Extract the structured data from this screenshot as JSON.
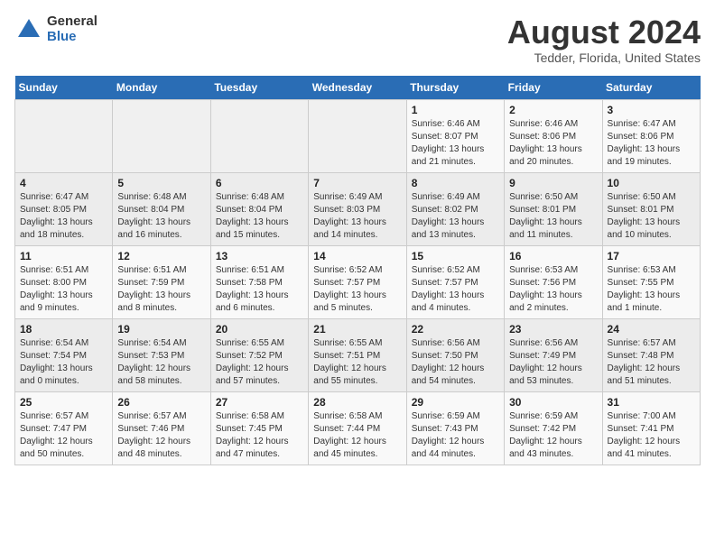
{
  "header": {
    "logo_general": "General",
    "logo_blue": "Blue",
    "title": "August 2024",
    "subtitle": "Tedder, Florida, United States"
  },
  "calendar": {
    "days_of_week": [
      "Sunday",
      "Monday",
      "Tuesday",
      "Wednesday",
      "Thursday",
      "Friday",
      "Saturday"
    ],
    "weeks": [
      [
        {
          "day": "",
          "info": ""
        },
        {
          "day": "",
          "info": ""
        },
        {
          "day": "",
          "info": ""
        },
        {
          "day": "",
          "info": ""
        },
        {
          "day": "1",
          "info": "Sunrise: 6:46 AM\nSunset: 8:07 PM\nDaylight: 13 hours\nand 21 minutes."
        },
        {
          "day": "2",
          "info": "Sunrise: 6:46 AM\nSunset: 8:06 PM\nDaylight: 13 hours\nand 20 minutes."
        },
        {
          "day": "3",
          "info": "Sunrise: 6:47 AM\nSunset: 8:06 PM\nDaylight: 13 hours\nand 19 minutes."
        }
      ],
      [
        {
          "day": "4",
          "info": "Sunrise: 6:47 AM\nSunset: 8:05 PM\nDaylight: 13 hours\nand 18 minutes."
        },
        {
          "day": "5",
          "info": "Sunrise: 6:48 AM\nSunset: 8:04 PM\nDaylight: 13 hours\nand 16 minutes."
        },
        {
          "day": "6",
          "info": "Sunrise: 6:48 AM\nSunset: 8:04 PM\nDaylight: 13 hours\nand 15 minutes."
        },
        {
          "day": "7",
          "info": "Sunrise: 6:49 AM\nSunset: 8:03 PM\nDaylight: 13 hours\nand 14 minutes."
        },
        {
          "day": "8",
          "info": "Sunrise: 6:49 AM\nSunset: 8:02 PM\nDaylight: 13 hours\nand 13 minutes."
        },
        {
          "day": "9",
          "info": "Sunrise: 6:50 AM\nSunset: 8:01 PM\nDaylight: 13 hours\nand 11 minutes."
        },
        {
          "day": "10",
          "info": "Sunrise: 6:50 AM\nSunset: 8:01 PM\nDaylight: 13 hours\nand 10 minutes."
        }
      ],
      [
        {
          "day": "11",
          "info": "Sunrise: 6:51 AM\nSunset: 8:00 PM\nDaylight: 13 hours\nand 9 minutes."
        },
        {
          "day": "12",
          "info": "Sunrise: 6:51 AM\nSunset: 7:59 PM\nDaylight: 13 hours\nand 8 minutes."
        },
        {
          "day": "13",
          "info": "Sunrise: 6:51 AM\nSunset: 7:58 PM\nDaylight: 13 hours\nand 6 minutes."
        },
        {
          "day": "14",
          "info": "Sunrise: 6:52 AM\nSunset: 7:57 PM\nDaylight: 13 hours\nand 5 minutes."
        },
        {
          "day": "15",
          "info": "Sunrise: 6:52 AM\nSunset: 7:57 PM\nDaylight: 13 hours\nand 4 minutes."
        },
        {
          "day": "16",
          "info": "Sunrise: 6:53 AM\nSunset: 7:56 PM\nDaylight: 13 hours\nand 2 minutes."
        },
        {
          "day": "17",
          "info": "Sunrise: 6:53 AM\nSunset: 7:55 PM\nDaylight: 13 hours\nand 1 minute."
        }
      ],
      [
        {
          "day": "18",
          "info": "Sunrise: 6:54 AM\nSunset: 7:54 PM\nDaylight: 13 hours\nand 0 minutes."
        },
        {
          "day": "19",
          "info": "Sunrise: 6:54 AM\nSunset: 7:53 PM\nDaylight: 12 hours\nand 58 minutes."
        },
        {
          "day": "20",
          "info": "Sunrise: 6:55 AM\nSunset: 7:52 PM\nDaylight: 12 hours\nand 57 minutes."
        },
        {
          "day": "21",
          "info": "Sunrise: 6:55 AM\nSunset: 7:51 PM\nDaylight: 12 hours\nand 55 minutes."
        },
        {
          "day": "22",
          "info": "Sunrise: 6:56 AM\nSunset: 7:50 PM\nDaylight: 12 hours\nand 54 minutes."
        },
        {
          "day": "23",
          "info": "Sunrise: 6:56 AM\nSunset: 7:49 PM\nDaylight: 12 hours\nand 53 minutes."
        },
        {
          "day": "24",
          "info": "Sunrise: 6:57 AM\nSunset: 7:48 PM\nDaylight: 12 hours\nand 51 minutes."
        }
      ],
      [
        {
          "day": "25",
          "info": "Sunrise: 6:57 AM\nSunset: 7:47 PM\nDaylight: 12 hours\nand 50 minutes."
        },
        {
          "day": "26",
          "info": "Sunrise: 6:57 AM\nSunset: 7:46 PM\nDaylight: 12 hours\nand 48 minutes."
        },
        {
          "day": "27",
          "info": "Sunrise: 6:58 AM\nSunset: 7:45 PM\nDaylight: 12 hours\nand 47 minutes."
        },
        {
          "day": "28",
          "info": "Sunrise: 6:58 AM\nSunset: 7:44 PM\nDaylight: 12 hours\nand 45 minutes."
        },
        {
          "day": "29",
          "info": "Sunrise: 6:59 AM\nSunset: 7:43 PM\nDaylight: 12 hours\nand 44 minutes."
        },
        {
          "day": "30",
          "info": "Sunrise: 6:59 AM\nSunset: 7:42 PM\nDaylight: 12 hours\nand 43 minutes."
        },
        {
          "day": "31",
          "info": "Sunrise: 7:00 AM\nSunset: 7:41 PM\nDaylight: 12 hours\nand 41 minutes."
        }
      ]
    ]
  }
}
